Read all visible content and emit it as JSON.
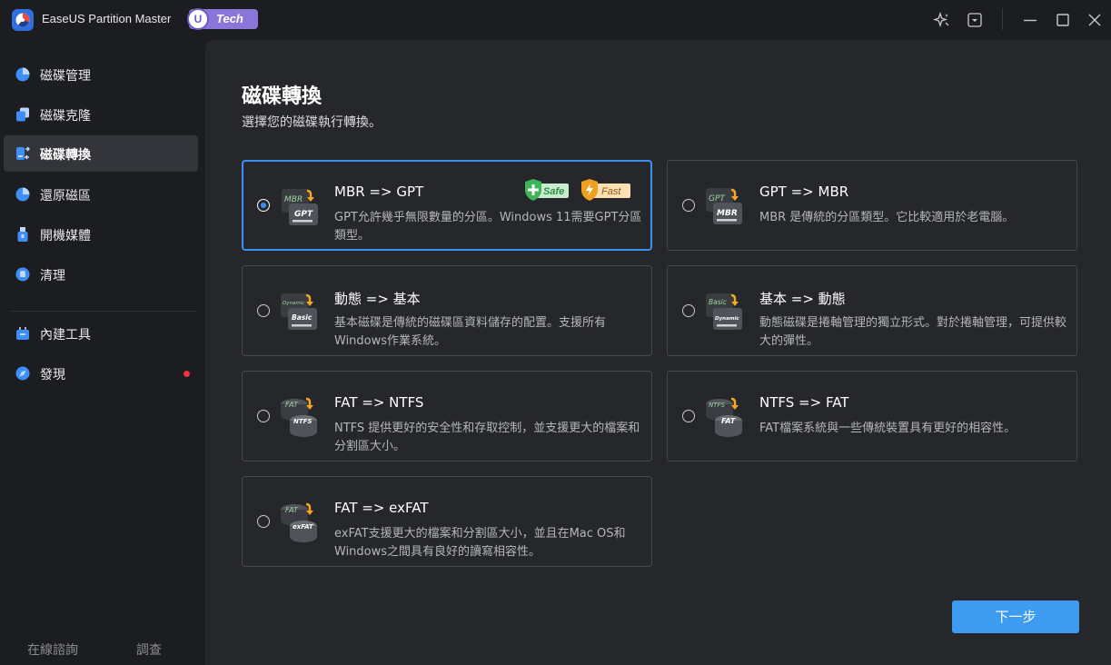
{
  "app": {
    "title": "EaseUS Partition Master",
    "badge_letter": "U",
    "badge_label": "Tech"
  },
  "sidebar": {
    "items": [
      {
        "label": "磁碟管理",
        "icon": "pie-chart-icon"
      },
      {
        "label": "磁碟克隆",
        "icon": "clone-icon"
      },
      {
        "label": "磁碟轉換",
        "icon": "convert-icon",
        "active": true
      },
      {
        "label": "還原磁區",
        "icon": "recover-icon"
      },
      {
        "label": "開機媒體",
        "icon": "usb-icon"
      },
      {
        "label": "清理",
        "icon": "cleanup-icon"
      },
      {
        "label": "內建工具",
        "icon": "toolbox-icon"
      },
      {
        "label": "發現",
        "icon": "discover-icon",
        "notification_dot": true
      }
    ],
    "footer": {
      "support": "在線諮詢",
      "survey": "調查"
    }
  },
  "main": {
    "title": "磁碟轉換",
    "subtitle": "選擇您的磁碟執行轉換。",
    "chips": {
      "safe": "Safe",
      "fast": "Fast"
    },
    "options": [
      {
        "title": "MBR => GPT",
        "desc": "GPT允許幾乎無限數量的分區。Windows 11需要GPT分區類型。",
        "selected": true,
        "from": "MBR",
        "to": "GPT"
      },
      {
        "title": "GPT => MBR",
        "desc": "MBR 是傳統的分區類型。它比較適用於老電腦。",
        "selected": false,
        "from": "GPT",
        "to": "MBR"
      },
      {
        "title": "動態 => 基本",
        "desc": "基本磁碟是傳統的磁碟區資料儲存的配置。支援所有Windows作業系統。",
        "selected": false,
        "from": "Dynamic",
        "to": "Basic"
      },
      {
        "title": "基本 => 動態",
        "desc": "動態磁碟是捲軸管理的獨立形式。對於捲軸管理，可提供較大的彈性。",
        "selected": false,
        "from": "Basic",
        "to": "Dynamic"
      },
      {
        "title": "FAT => NTFS",
        "desc": "NTFS 提供更好的安全性和存取控制，並支援更大的檔案和分割區大小。",
        "selected": false,
        "from": "FAT",
        "to": "NTFS"
      },
      {
        "title": "NTFS => FAT",
        "desc": "FAT檔案系統與一些傳統裝置具有更好的相容性。",
        "selected": false,
        "from": "NTFS",
        "to": "FAT"
      },
      {
        "title": "FAT => exFAT",
        "desc": "exFAT支援更大的檔案和分割區大小，並且在Mac OS和Windows之間具有良好的讀寫相容性。",
        "selected": false,
        "from": "FAT",
        "to": "exFAT"
      }
    ],
    "next_label": "下一步"
  },
  "colors": {
    "accent": "#3d8ff0",
    "button": "#3d9bf0",
    "safe": "#3fb55a",
    "fast": "#f0a020",
    "badge": "#8a76d8",
    "notification": "#f0303a"
  }
}
